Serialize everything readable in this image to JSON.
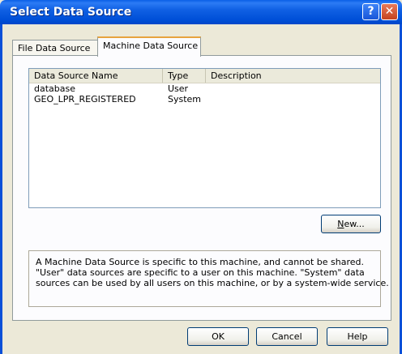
{
  "window": {
    "title": "Select Data Source"
  },
  "tabs": [
    {
      "label": "File Data Source"
    },
    {
      "label": "Machine Data Source"
    }
  ],
  "list": {
    "columns": [
      "Data Source Name",
      "Type",
      "Description"
    ],
    "rows": [
      {
        "name": "database",
        "type": "User",
        "description": ""
      },
      {
        "name": "GEO_LPR_REGISTERED",
        "type": "System",
        "description": ""
      }
    ]
  },
  "buttons": {
    "new": {
      "text": "ew...",
      "underline": "N"
    },
    "ok": "OK",
    "cancel": "Cancel",
    "help": "Help"
  },
  "info": {
    "lines": [
      "A Machine Data Source is specific to this machine, and cannot be shared.",
      "\"User\" data sources are specific to a user on this machine.  \"System\" data",
      "sources can be used by all users on this machine, or by a system-wide service."
    ]
  },
  "icons": {
    "help": "question-icon",
    "close": "close-icon"
  }
}
